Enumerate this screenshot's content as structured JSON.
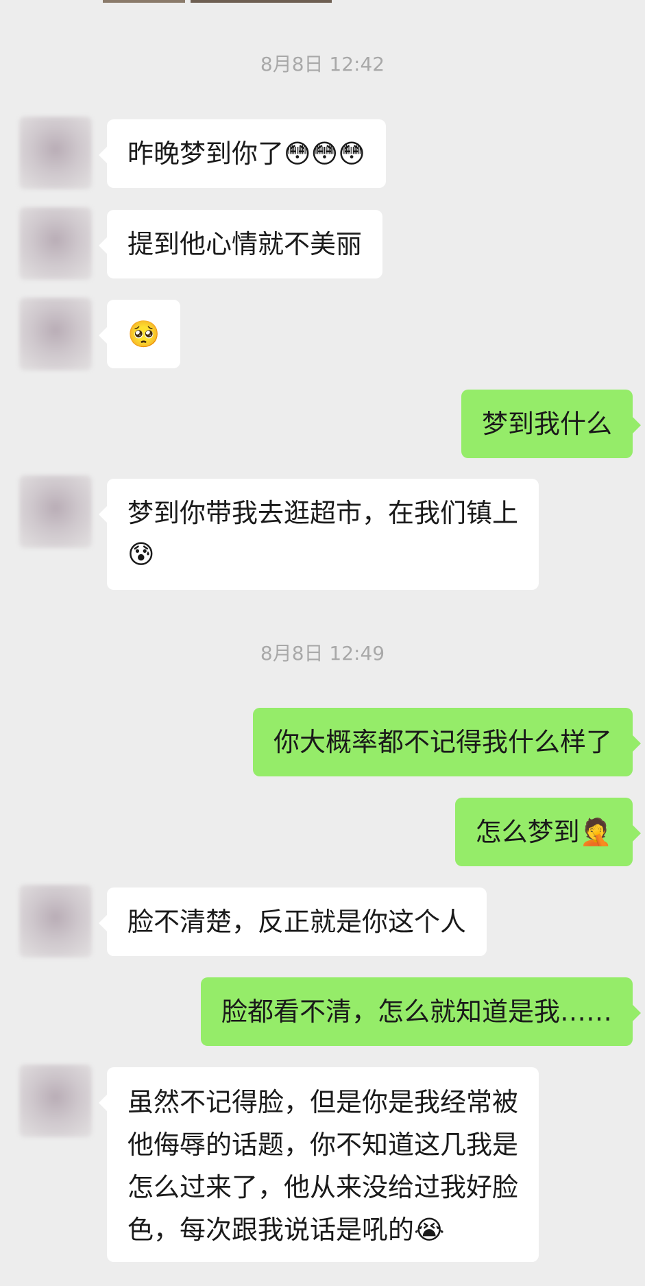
{
  "timestamps": [
    "8月8日 12:42",
    "8月8日 12:49"
  ],
  "messages": [
    {
      "side": "in",
      "text": "昨晚梦到你了😳😳😳"
    },
    {
      "side": "in",
      "text": "提到他心情就不美丽"
    },
    {
      "side": "in",
      "text": "🥺"
    },
    {
      "side": "out",
      "text": "梦到我什么"
    },
    {
      "side": "in",
      "text": "梦到你带我去逛超市，在我们镇上\n😰"
    },
    {
      "side": "out",
      "text": "你大概率都不记得我什么样了"
    },
    {
      "side": "out",
      "text": "怎么梦到🤦"
    },
    {
      "side": "in",
      "text": "脸不清楚，反正就是你这个人"
    },
    {
      "side": "out",
      "text": "脸都看不清，怎么就知道是我……"
    },
    {
      "side": "in",
      "text": "虽然不记得脸，但是你是我经常被\n他侮辱的话题，你不知道这几我是\n怎么过来了，他从来没给过我好脸\n色，每次跟我说话是吼的😭"
    }
  ],
  "colors": {
    "background": "#ededed",
    "incoming_bubble": "#ffffff",
    "outgoing_bubble": "#95ec69",
    "timestamp_text": "#a8a8a8"
  }
}
